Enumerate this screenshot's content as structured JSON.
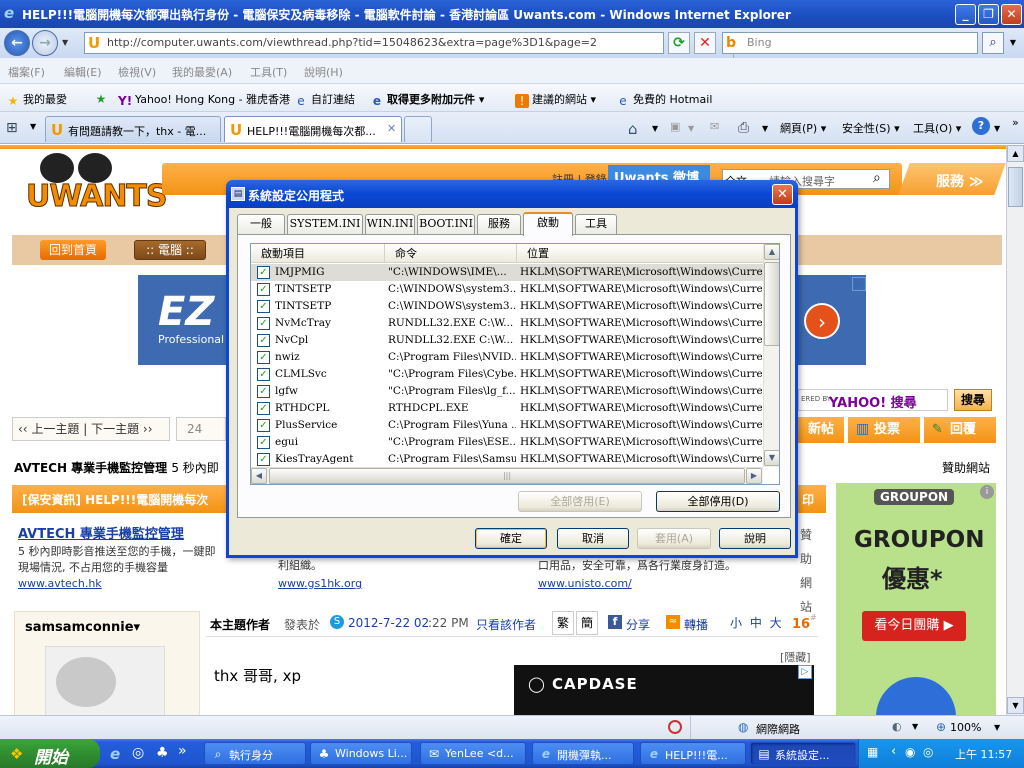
{
  "window": {
    "title": "HELP!!!電腦開機每次都彈出執行身份 - 電腦保安及病毒移除 - 電腦軟件討論 - 香港討論區 Uwants.com - Windows Internet Explorer",
    "icon": "ie-icon"
  },
  "address": {
    "url": "http://computer.uwants.com/viewthread.php?tid=15048623&extra=page%3D1&page=2",
    "search_placeholder": "Bing"
  },
  "menu": [
    "檔案(F)",
    "編輯(E)",
    "檢視(V)",
    "我的最愛(A)",
    "工具(T)",
    "說明(H)"
  ],
  "favorites_bar": {
    "favorites_label": "我的最愛",
    "items": [
      "Yahoo! Hong Kong - 雅虎香港",
      "自訂連結",
      "取得更多附加元件",
      "建議的網站",
      "免費的 Hotmail"
    ]
  },
  "tabs": [
    {
      "label": "有問題請教一下，thx - 電..."
    },
    {
      "label": "HELP!!!電腦開機每次都..."
    }
  ],
  "command_bar": {
    "page": "網頁(P)",
    "safety": "安全性(S)",
    "tools": "工具(O)"
  },
  "page": {
    "header_links": [
      "註冊",
      "登錄"
    ],
    "search_placeholder": "請輸入搜尋字",
    "search_scope": "全文",
    "service_label": "服務",
    "weibo_label": "Uwants 微博",
    "nav_home": "回到首頁",
    "nav_computer": ":: 電腦 ::",
    "banner_text": "EZ",
    "banner_sub": "Professional",
    "prev_next": "‹‹ 上一主題 | 下一主題 ››",
    "page_num": "24",
    "yahoo_label": "YAHOO! 搜尋",
    "yahoo_prefix": "ERED BY",
    "search_btn": "搜尋",
    "new_post": "新帖",
    "vote": "投票",
    "reply": "回覆",
    "ad_title": "AVTECH 專業手機監控管理",
    "ad_title_suffix": "5 秒內即",
    "sponsor": "贊助網站",
    "notice": "[保安資訊] HELP!!!電腦開機每次",
    "notice_right": "印",
    "ad1_title": "AVTECH 專業手機監控管理",
    "ad1_text": "5 秒內即時影音推送至您的手機，一鍵即\n現場情況, 不占用您的手機容量",
    "ad1_url": "www.avtech.hk",
    "ad2_text": "利組織。",
    "ad2_url": "www.gs1hk.org",
    "ad3_text": "口用品，安全可靠，爲各行業度身訂造。",
    "ad3_url": "www.unisto.com/",
    "side_sponsor": "贊助網站",
    "username": "samsamconnie",
    "post_author": "本主題作者",
    "posted_at": "發表於",
    "post_date": "2012-7-22 02",
    "post_time": ":22 PM",
    "only_author": "只看該作者",
    "trad": "繁",
    "simp": "簡",
    "share": "分享",
    "forward": "轉播",
    "font_sizes": "小 中 大",
    "floor": "16",
    "hidden": "[隱藏]",
    "post_text": "thx 哥哥, xp",
    "capdase": "CAPDASE",
    "groupon_en": "GROUPON",
    "groupon_big": "GROUPON",
    "groupon_cn": "優惠*",
    "groupon_btn": "看今日團購"
  },
  "dialog": {
    "title": "系統設定公用程式",
    "tabs": [
      "一般",
      "SYSTEM.INI",
      "WIN.INI",
      "BOOT.INI",
      "服務",
      "啟動",
      "工具"
    ],
    "active_tab": "啟動",
    "columns": [
      "啟動項目",
      "命令",
      "位置"
    ],
    "rows": [
      {
        "item": "IMJPMIG",
        "command": "\"C:\\WINDOWS\\IME\\...",
        "location": "HKLM\\SOFTWARE\\Microsoft\\Windows\\CurrentV...",
        "checked": true,
        "selected": true
      },
      {
        "item": "TINTSETP",
        "command": "C:\\WINDOWS\\system3...",
        "location": "HKLM\\SOFTWARE\\Microsoft\\Windows\\CurrentV...",
        "checked": true
      },
      {
        "item": "TINTSETP",
        "command": "C:\\WINDOWS\\system3...",
        "location": "HKLM\\SOFTWARE\\Microsoft\\Windows\\CurrentV...",
        "checked": true
      },
      {
        "item": "NvMcTray",
        "command": "RUNDLL32.EXE C:\\W...",
        "location": "HKLM\\SOFTWARE\\Microsoft\\Windows\\CurrentV...",
        "checked": true
      },
      {
        "item": "NvCpl",
        "command": "RUNDLL32.EXE C:\\W...",
        "location": "HKLM\\SOFTWARE\\Microsoft\\Windows\\CurrentV...",
        "checked": true
      },
      {
        "item": "nwiz",
        "command": "C:\\Program Files\\NVID...",
        "location": "HKLM\\SOFTWARE\\Microsoft\\Windows\\CurrentV...",
        "checked": true
      },
      {
        "item": "CLMLSvc",
        "command": "\"C:\\Program Files\\Cybe...",
        "location": "HKLM\\SOFTWARE\\Microsoft\\Windows\\CurrentV...",
        "checked": true
      },
      {
        "item": "lgfw",
        "command": "\"C:\\Program Files\\lg_f...",
        "location": "HKLM\\SOFTWARE\\Microsoft\\Windows\\CurrentV...",
        "checked": true
      },
      {
        "item": "RTHDCPL",
        "command": "RTHDCPL.EXE",
        "location": "HKLM\\SOFTWARE\\Microsoft\\Windows\\CurrentV...",
        "checked": true
      },
      {
        "item": "PlusService",
        "command": "C:\\Program Files\\Yuna ...",
        "location": "HKLM\\SOFTWARE\\Microsoft\\Windows\\CurrentV...",
        "checked": true
      },
      {
        "item": "egui",
        "command": "\"C:\\Program Files\\ESE...",
        "location": "HKLM\\SOFTWARE\\Microsoft\\Windows\\CurrentV...",
        "checked": true
      },
      {
        "item": "KiesTrayAgent",
        "command": "C:\\Program Files\\Samsu...",
        "location": "HKLM\\SOFTWARE\\Microsoft\\Windows\\CurrentV...",
        "checked": true
      }
    ],
    "enable_all": "全部啓用(E)",
    "disable_all": "全部停用(D)",
    "ok": "確定",
    "cancel": "取消",
    "apply": "套用(A)",
    "help": "說明"
  },
  "status": {
    "zone": "網際網路",
    "zoom": "100%"
  },
  "taskbar": {
    "start": "開始",
    "tasks": [
      "執行身分",
      "Windows Li...",
      "YenLee <d...",
      "開機彈執...",
      "HELP!!!電...",
      "系統設定..."
    ],
    "active_task": 5,
    "clock": "上午 11:57"
  }
}
